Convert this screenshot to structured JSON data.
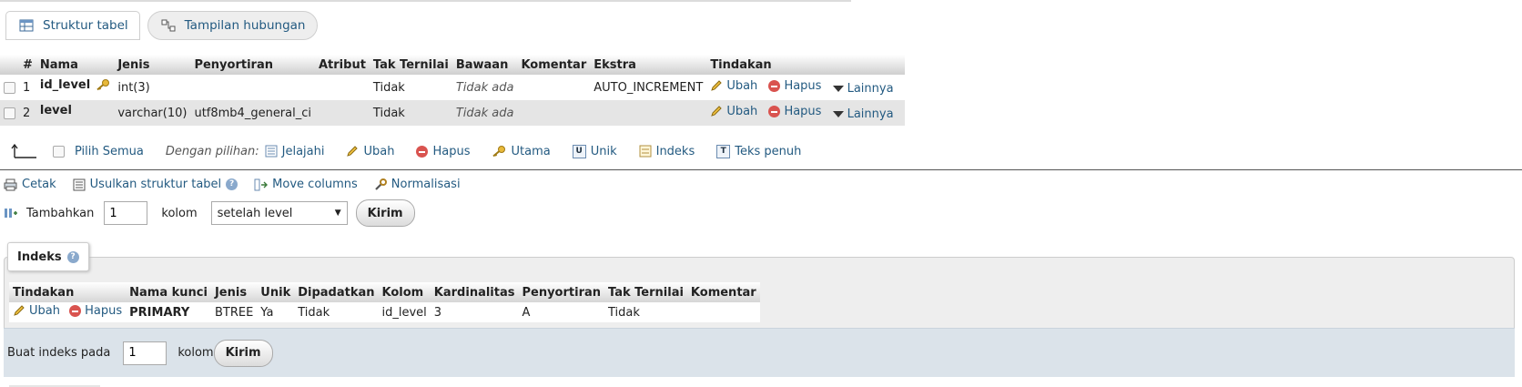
{
  "tabs": [
    {
      "label": "Struktur tabel",
      "icon": "table-structure-icon"
    },
    {
      "label": "Tampilan hubungan",
      "icon": "relation-view-icon"
    }
  ],
  "structure": {
    "headers": [
      "",
      "#",
      "Nama",
      "Jenis",
      "Penyortiran",
      "Atribut",
      "Tak Ternilai",
      "Bawaan",
      "Komentar",
      "Ekstra",
      "Tindakan"
    ],
    "rows": [
      {
        "num": "1",
        "name": "id_level",
        "primary_key": true,
        "type": "int(3)",
        "collation": "",
        "attributes": "",
        "null": "Tidak",
        "default": "Tidak ada",
        "comment": "",
        "extra": "AUTO_INCREMENT"
      },
      {
        "num": "2",
        "name": "level",
        "primary_key": false,
        "type": "varchar(10)",
        "collation": "utf8mb4_general_ci",
        "attributes": "",
        "null": "Tidak",
        "default": "Tidak ada",
        "comment": "",
        "extra": ""
      }
    ],
    "actions": {
      "change": "Ubah",
      "drop": "Hapus",
      "more": "Lainnya"
    }
  },
  "with_selected": {
    "check_all": "Pilih Semua",
    "label": "Dengan pilihan:",
    "browse": "Jelajahi",
    "change": "Ubah",
    "drop": "Hapus",
    "primary": "Utama",
    "unique": "Unik",
    "index": "Indeks",
    "fulltext": "Teks penuh"
  },
  "links": {
    "print": "Cetak",
    "propose": "Usulkan struktur tabel",
    "move_columns": "Move columns",
    "normalize": "Normalisasi"
  },
  "add_column": {
    "label": "Tambahkan",
    "count": "1",
    "unit": "kolom",
    "position": "setelah level",
    "submit": "Kirim"
  },
  "indexes": {
    "legend": "Indeks",
    "headers": [
      "Tindakan",
      "Nama kunci",
      "Jenis",
      "Unik",
      "Dipadatkan",
      "Kolom",
      "Kardinalitas",
      "Penyortiran",
      "Tak Ternilai",
      "Komentar"
    ],
    "rows": [
      {
        "change": "Ubah",
        "drop": "Hapus",
        "keyname": "PRIMARY",
        "type": "BTREE",
        "unique": "Ya",
        "packed": "Tidak",
        "column": "id_level",
        "cardinality": "3",
        "collation": "A",
        "null": "Tidak",
        "comment": ""
      }
    ],
    "create_label": "Buat indeks pada",
    "create_count": "1",
    "create_unit": "kolom",
    "create_submit": "Kirim"
  },
  "colors": {
    "link": "#235a81",
    "drop": "#d9534f",
    "header_bg": "#cfcfcf",
    "footer_bg": "#dbe3ea"
  }
}
